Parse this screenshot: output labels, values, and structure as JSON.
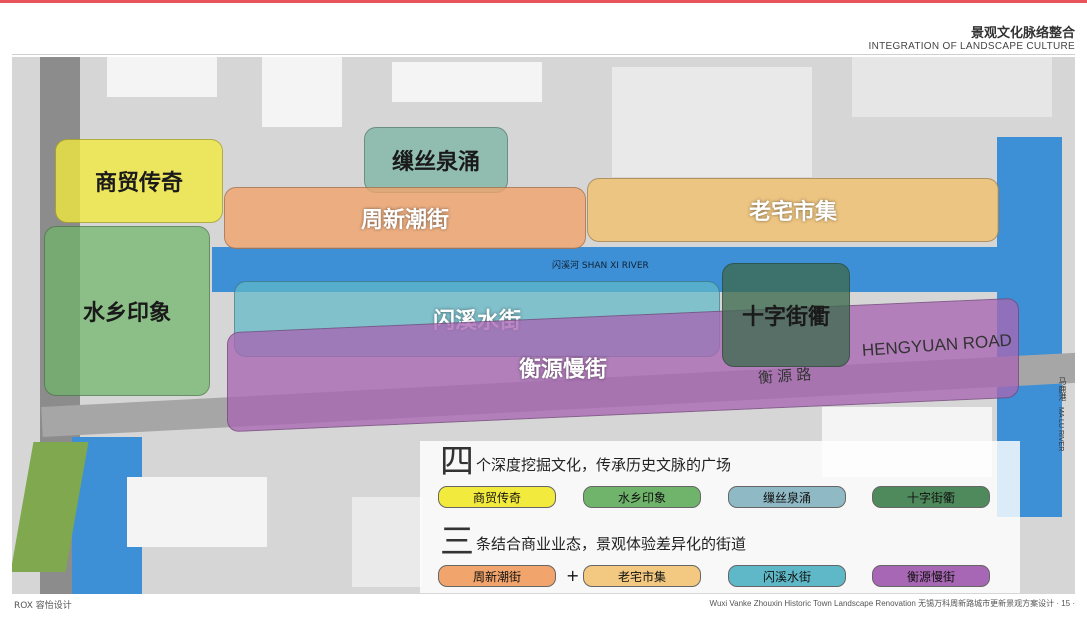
{
  "header": {
    "title_cn": "景观文化脉络整合",
    "title_en": "INTEGRATION OF LANDSCAPE CULTURE"
  },
  "map": {
    "zones": [
      {
        "label": "商贸传奇",
        "color": "#f2ea3c"
      },
      {
        "label": "缫丝泉涌",
        "color": "#7fb7a6"
      },
      {
        "label": "周新潮街",
        "color": "#f1a46b"
      },
      {
        "label": "老宅市集",
        "color": "#f3c06a"
      },
      {
        "label": "水乡印象",
        "color": "#6fb46a"
      },
      {
        "label": "闪溪水街",
        "color": "#5fb8c8"
      },
      {
        "label": "十字街衢",
        "color": "#3d6a4e"
      },
      {
        "label": "衡源慢街",
        "color": "#a867b4"
      }
    ],
    "river_label": "闪溪河  SHAN XI RIVER",
    "road_label_en": "HENGYUAN ROAD",
    "road_label_cn": "衡 源 路",
    "road_label_v_cn": "马鹿港",
    "road_label_v_en": "MA LU RIVER"
  },
  "legend": {
    "squares": {
      "num": "四",
      "title": "个深度挖掘文化，传承历史文脉的广场",
      "items": [
        {
          "label": "商贸传奇",
          "color": "#f2ea3c"
        },
        {
          "label": "水乡印象",
          "color": "#6fb46a"
        },
        {
          "label": "缫丝泉涌",
          "color": "#8fb9c4"
        },
        {
          "label": "十字街衢",
          "color": "#4e8a5c"
        }
      ]
    },
    "streets": {
      "num": "三",
      "title": "条结合商业业态，景观体验差异化的街道",
      "items": [
        {
          "label": "周新潮街",
          "color": "#f1a46b"
        },
        {
          "label": "老宅市集",
          "color": "#f3c982"
        },
        {
          "label": "闪溪水街",
          "color": "#5fb8c8"
        },
        {
          "label": "衡源慢街",
          "color": "#a867b4"
        }
      ],
      "plus": "+"
    }
  },
  "footer": {
    "left": "ROX 容怡设计",
    "right": "Wuxi Vanke Zhouxin Historic Town Landscape Renovation   无锡万科周新路城市更新景观方案设计  · 15 ·"
  }
}
